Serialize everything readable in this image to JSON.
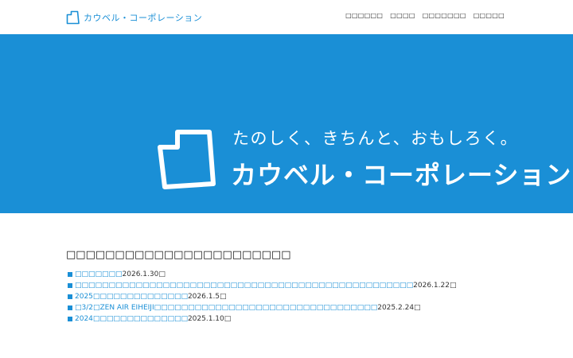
{
  "header": {
    "logo_text": "カウベル・コーポレーション",
    "nav": [
      "□□□□□□",
      "□□□□",
      "□□□□□□□",
      "□□□□□"
    ]
  },
  "hero": {
    "tagline": "たのしく、きちんと、おもしろく。",
    "name": "カウベル・コーポレーション"
  },
  "news": {
    "title": "□□□□□□□□□□□□□□□□□□□□□□□",
    "items": [
      {
        "link": "□□□□□□□",
        "date": "2026.1.30□"
      },
      {
        "link": "□□□□□□□□□□□□□□□□□□□□□□□□□□□□□□□□□□□□□□□□□□□□□□□□□□",
        "date": "2026.1.22□"
      },
      {
        "link": "2025□□□□□□□□□□□□□□",
        "date": "2026.1.5□"
      },
      {
        "link": "□3/2□ZEN AIR EIHEIJI□□□□□□□□□□□□□□□□□□□□□□□□□□□□□□□□□",
        "date": "2025.2.24□"
      },
      {
        "link": "2024□□□□□□□□□□□□□□",
        "date": "2025.1.10□"
      }
    ]
  },
  "colors": {
    "accent": "#1a8fd6",
    "background": "#ffffff"
  }
}
